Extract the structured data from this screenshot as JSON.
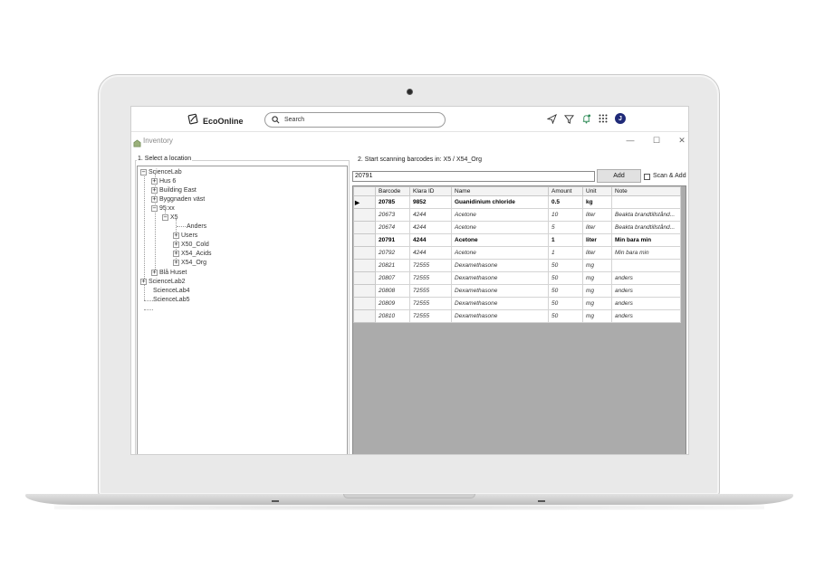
{
  "header": {
    "brand": "EcoOnline",
    "search_placeholder": "Search",
    "avatar_initial": "J",
    "icons": [
      "leaf-logo-icon",
      "search-icon",
      "send-icon",
      "filter-icon",
      "bell-icon",
      "apps-grid-icon"
    ],
    "colors": {
      "avatar_bg": "#1f2a78",
      "bell_accent": "#2e8b57"
    }
  },
  "window": {
    "title": "Inventory",
    "minimize": "—",
    "maximize": "☐",
    "close": "✕"
  },
  "left_panel": {
    "caption": "1. Select a location",
    "tree": [
      {
        "label": "ScienceLab",
        "expander": "−"
      },
      {
        "label": "Hus 6",
        "expander": "+"
      },
      {
        "label": "Building East",
        "expander": "+"
      },
      {
        "label": "Byggnaden väst",
        "expander": "+"
      },
      {
        "label": "95:xx",
        "expander": "−"
      },
      {
        "label": "X5",
        "expander": "−"
      },
      {
        "label": "Anders",
        "expander": ""
      },
      {
        "label": "Users",
        "expander": "+"
      },
      {
        "label": "X50_Cold",
        "expander": "+"
      },
      {
        "label": "X54_Acids",
        "expander": "+"
      },
      {
        "label": "X54_Org",
        "expander": "+"
      },
      {
        "label": "Blå Huset",
        "expander": "+"
      },
      {
        "label": "ScienceLab2",
        "expander": "+"
      },
      {
        "label": "ScienceLab4",
        "expander": ""
      },
      {
        "label": "ScienceLab5",
        "expander": ""
      }
    ]
  },
  "right_panel": {
    "caption": "2. Start scanning barcodes in: X5 / X54_Org",
    "barcode_value": "20791",
    "add_label": "Add",
    "scan_add_label": "Scan & Add",
    "scan_add_checked": false,
    "columns": [
      "Barcode",
      "Klara ID",
      "Name",
      "Amount",
      "Unit",
      "Note"
    ],
    "rows": [
      {
        "marker": "▶",
        "style": "bold",
        "cells": [
          "20785",
          "9852",
          "Guanidinium chloride",
          "0.5",
          "kg",
          ""
        ]
      },
      {
        "marker": "",
        "style": "italic",
        "cells": [
          "20673",
          "4244",
          "Acetone",
          "10",
          "liter",
          "Beakta brandtillstånd..."
        ]
      },
      {
        "marker": "",
        "style": "italic",
        "cells": [
          "20674",
          "4244",
          "Acetone",
          "5",
          "liter",
          "Beakta brandtillstånd..."
        ]
      },
      {
        "marker": "",
        "style": "bold",
        "cells": [
          "20791",
          "4244",
          "Acetone",
          "1",
          "liter",
          "Min bara min"
        ]
      },
      {
        "marker": "",
        "style": "italic",
        "cells": [
          "20792",
          "4244",
          "Acetone",
          "1",
          "liter",
          "Min bara min"
        ]
      },
      {
        "marker": "",
        "style": "italic",
        "cells": [
          "20821",
          "72555",
          "Dexamethasone",
          "50",
          "mg",
          ""
        ]
      },
      {
        "marker": "",
        "style": "italic",
        "cells": [
          "20807",
          "72555",
          "Dexamethasone",
          "50",
          "mg",
          "anders"
        ]
      },
      {
        "marker": "",
        "style": "italic",
        "cells": [
          "20808",
          "72555",
          "Dexamethasone",
          "50",
          "mg",
          "anders"
        ]
      },
      {
        "marker": "",
        "style": "italic",
        "cells": [
          "20809",
          "72555",
          "Dexamethasone",
          "50",
          "mg",
          "anders"
        ]
      },
      {
        "marker": "",
        "style": "italic",
        "cells": [
          "20810",
          "72555",
          "Dexamethasone",
          "50",
          "mg",
          "anders"
        ]
      }
    ]
  }
}
